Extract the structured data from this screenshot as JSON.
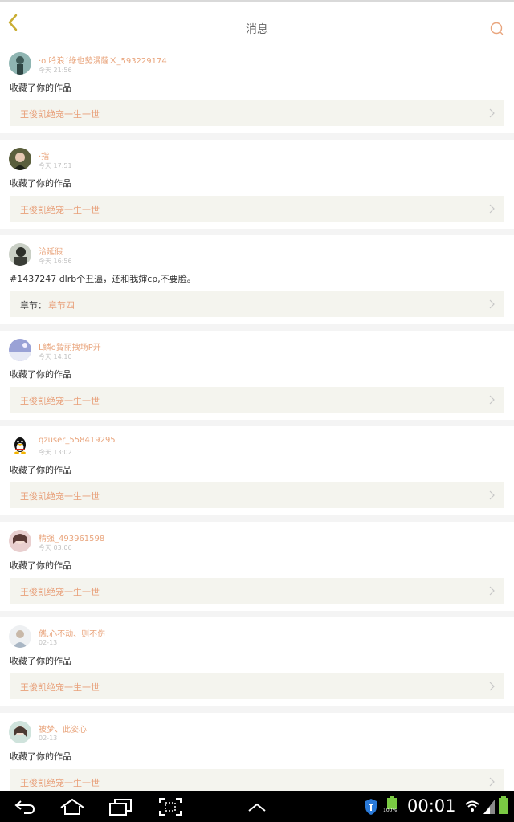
{
  "header": {
    "title": "消息",
    "back_icon": "chevron-left-icon",
    "search_icon": "search-icon"
  },
  "colors": {
    "accent": "#e9a57d",
    "link_bg": "#f4f4ee",
    "divider": "#f4f4f4",
    "back_arrow": "#c9ad32"
  },
  "messages": [
    {
      "user": "·o 吟浪´綠也勢漫薩ㄨ_593229174",
      "time": "今天 21:56",
      "text": "收藏了你的作品",
      "link_prefix": "",
      "link_label": "王俊凯绝宠一生一世",
      "avatar": "avatar-teal-icon"
    },
    {
      "user": "·指",
      "time": "今天 17:51",
      "text": "收藏了你的作品",
      "link_prefix": "",
      "link_label": "王俊凯绝宠一生一世",
      "avatar": "avatar-girl-icon"
    },
    {
      "user": "洽延徦",
      "time": "今天 16:56",
      "text": "#1437247 dlrb个丑逼，还和我婶cp,不要脸。",
      "link_prefix": "章节：",
      "link_label": "章节四",
      "avatar": "avatar-dark-icon"
    },
    {
      "user": "L鳞o贄丽拽场P开",
      "time": "今天 14:10",
      "text": "收藏了你的作品",
      "link_prefix": "",
      "link_label": "王俊凯绝宠一生一世",
      "avatar": "avatar-sky-icon"
    },
    {
      "user": "qzuser_558419295",
      "time": "今天 13:02",
      "text": "收藏了你的作品",
      "link_prefix": "",
      "link_label": "王俊凯绝宠一生一世",
      "avatar": "qq-penguin-icon"
    },
    {
      "user": "精强_493961598",
      "time": "今天 03:06",
      "text": "收藏了你的作品",
      "link_prefix": "",
      "link_label": "王俊凯绝宠一生一世",
      "avatar": "avatar-pink-icon"
    },
    {
      "user": "儶,心不动、则不伤",
      "time": "02-13",
      "text": "收藏了你的作品",
      "link_prefix": "",
      "link_label": "王俊凯绝宠一生一世",
      "avatar": "avatar-light-icon"
    },
    {
      "user": "被梦、此姿心",
      "time": "02-13",
      "text": "收藏了你的作品",
      "link_prefix": "",
      "link_label": "王俊凯绝宠一生一世",
      "avatar": "avatar-mint-icon"
    }
  ],
  "navbar": {
    "back_icon": "back-arrow-icon",
    "home_icon": "home-icon",
    "recents_icon": "recents-icon",
    "screenshot_icon": "screenshot-icon",
    "menu_icon": "chevron-up-icon",
    "shield_icon": "shield-icon",
    "battery_percent": "100%",
    "clock": "00:01"
  }
}
